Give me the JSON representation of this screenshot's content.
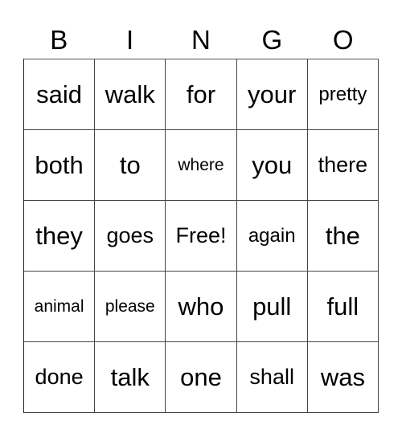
{
  "header": {
    "letters": [
      "B",
      "I",
      "N",
      "G",
      "O"
    ]
  },
  "board": {
    "rows": [
      [
        "said",
        "walk",
        "for",
        "your",
        "pretty"
      ],
      [
        "both",
        "to",
        "where",
        "you",
        "there"
      ],
      [
        "they",
        "goes",
        "Free!",
        "again",
        "the"
      ],
      [
        "animal",
        "please",
        "who",
        "pull",
        "full"
      ],
      [
        "done",
        "talk",
        "one",
        "shall",
        "was"
      ]
    ]
  }
}
